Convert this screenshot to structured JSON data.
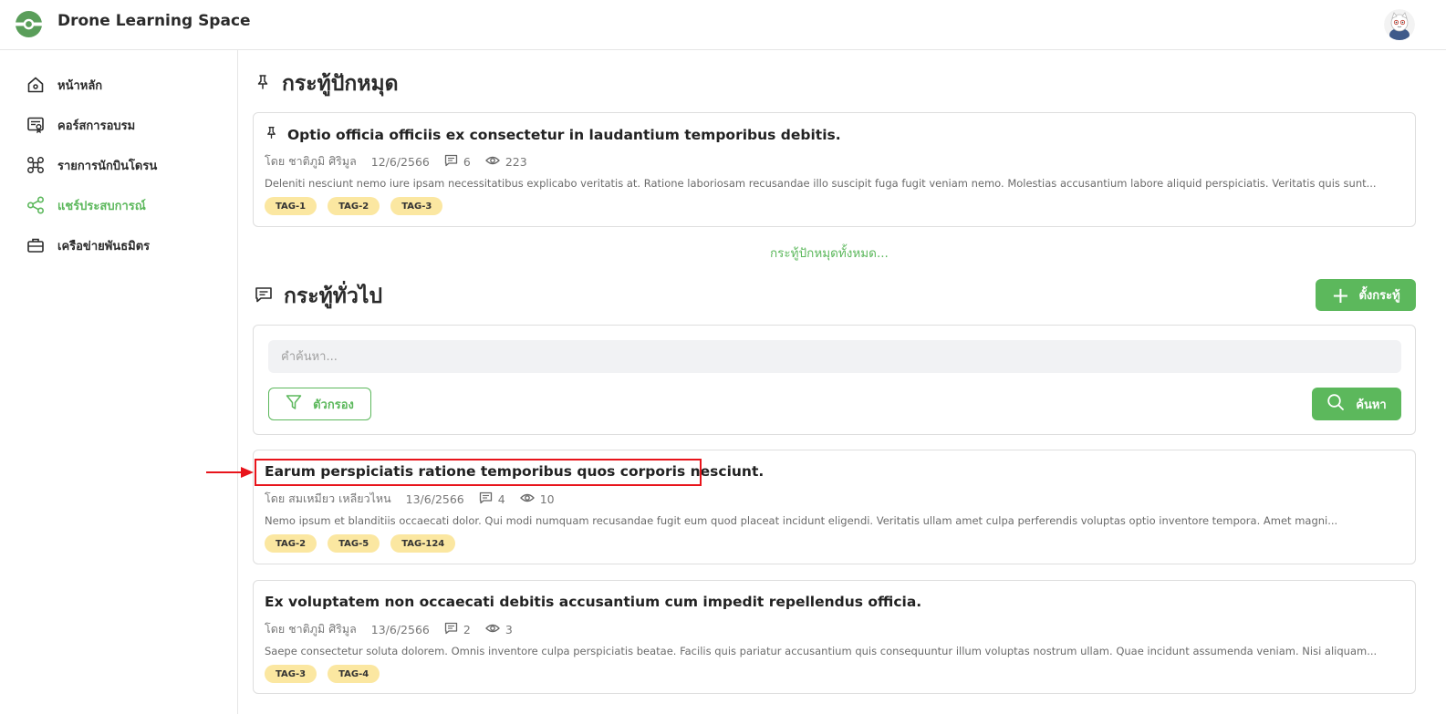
{
  "app": {
    "title": "Drone Learning Space"
  },
  "sidebar": {
    "items": [
      {
        "label": "หน้าหลัก",
        "icon": "home-icon",
        "active": false
      },
      {
        "label": "คอร์สการอบรม",
        "icon": "certificate-icon",
        "active": false
      },
      {
        "label": "รายการนักบินโดรน",
        "icon": "drone-icon",
        "active": false
      },
      {
        "label": "แชร์ประสบการณ์",
        "icon": "share-icon",
        "active": true
      },
      {
        "label": "เครือข่ายพันธมิตร",
        "icon": "briefcase-icon",
        "active": false
      }
    ]
  },
  "pinned": {
    "title": "กระทู้ปักหมุด",
    "see_all": "กระทู้ปักหมุดทั้งหมด...",
    "posts": [
      {
        "title": "Optio officia officiis ex consectetur in laudantium temporibus debitis.",
        "author": "โดย ชาติภูมิ ศิริมูล",
        "date": "12/6/2566",
        "comments": "6",
        "views": "223",
        "excerpt": "Deleniti nesciunt nemo iure ipsam necessitatibus explicabo veritatis at. Ratione laboriosam recusandae illo suscipit fuga fugit veniam nemo. Molestias accusantium labore aliquid perspiciatis. Veritatis quis sunt...",
        "tags": [
          "TAG-1",
          "TAG-2",
          "TAG-3"
        ]
      }
    ]
  },
  "general": {
    "title": "กระทู้ทั่วไป",
    "new_post_label": "ตั้งกระทู้",
    "search": {
      "placeholder": "คำค้นหา...",
      "value": "",
      "filter_label": "ตัวกรอง",
      "search_label": "ค้นหา"
    },
    "posts": [
      {
        "title": "Earum perspiciatis ratione temporibus quos corporis nesciunt.",
        "author": "โดย สมเหมียว เหลียวไหน",
        "date": "13/6/2566",
        "comments": "4",
        "views": "10",
        "excerpt": "Nemo ipsum et blanditiis occaecati dolor. Qui modi numquam recusandae fugit eum quod placeat incidunt eligendi. Veritatis ullam amet culpa perferendis voluptas optio inventore tempora. Amet magni...",
        "tags": [
          "TAG-2",
          "TAG-5",
          "TAG-124"
        ]
      },
      {
        "title": "Ex voluptatem non occaecati debitis accusantium cum impedit repellendus officia.",
        "author": "โดย ชาติภูมิ ศิริมูล",
        "date": "13/6/2566",
        "comments": "2",
        "views": "3",
        "excerpt": "Saepe consectetur soluta dolorem. Omnis inventore culpa perspiciatis beatae. Facilis quis pariatur accusantium quis consequuntur illum voluptas nostrum ullam. Quae incidunt assumenda veniam. Nisi aliquam...",
        "tags": [
          "TAG-3",
          "TAG-4"
        ]
      }
    ]
  },
  "colors": {
    "accent": "#5cb85c",
    "tag_bg": "#fbe7a1",
    "highlight": "#e8141b"
  }
}
